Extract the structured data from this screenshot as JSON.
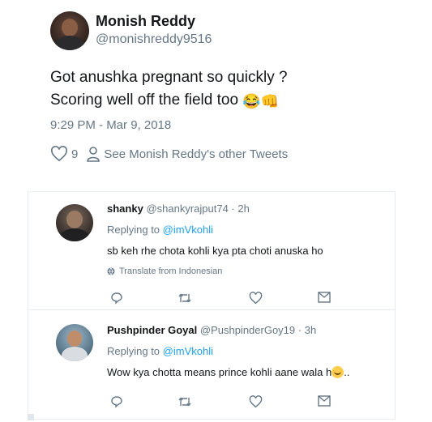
{
  "main_tweet": {
    "name": "Monish Reddy",
    "handle": "@monishreddy9516",
    "text_line1": "Got anushka pregnant so quickly ?",
    "text_line2": "Scoring well off the field too",
    "emojis": [
      "😂",
      "👊"
    ],
    "timestamp": "9:29 PM - Mar 9, 2018",
    "like_count": "9",
    "other_tweets_link": "See Monish Reddy's other Tweets"
  },
  "replies": [
    {
      "name": "shanky",
      "handle": "@shankyrajput74",
      "time": "2h",
      "replying_prefix": "Replying to",
      "replying_to": "@imVkohli",
      "text": "sb keh rhe chota kohli kya pta choti anuska ho",
      "translate": "Translate from Indonesian"
    },
    {
      "name": "Pushpinder Goyal",
      "handle": "@PushpinderGoy19",
      "time": "3h",
      "replying_prefix": "Replying to",
      "replying_to": "@imVkohli",
      "text": "Wow kya chotta means prince kohli aane wala h",
      "text_suffix": ".."
    }
  ],
  "separator": " · ",
  "colors": {
    "link": "#1da1f2",
    "muted": "#657786",
    "text": "#14171a",
    "divider": "#e6ecf0"
  }
}
